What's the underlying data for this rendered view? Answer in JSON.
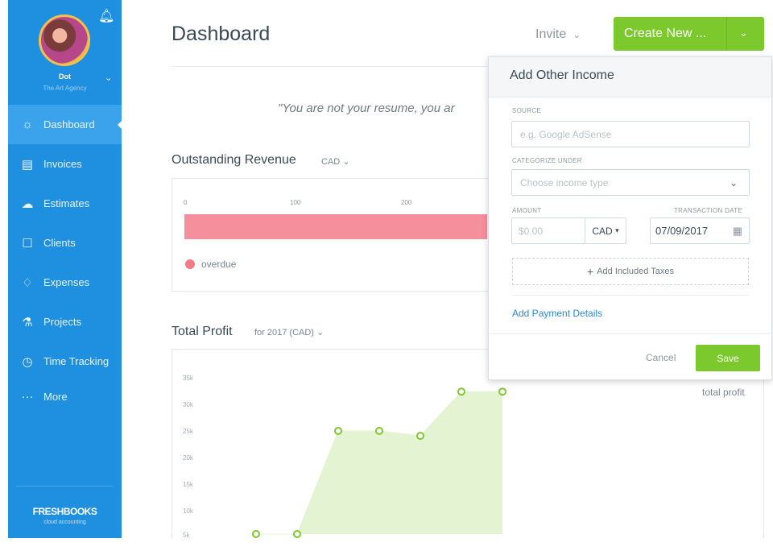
{
  "sidebar": {
    "user_name": "Dot",
    "agency": "The Art Agency",
    "items": [
      {
        "label": "Dashboard",
        "icon": "dashboard-icon",
        "glyph": "☼",
        "active": true
      },
      {
        "label": "Invoices",
        "icon": "invoice-icon",
        "glyph": "▤"
      },
      {
        "label": "Estimates",
        "icon": "estimate-icon",
        "glyph": "☁"
      },
      {
        "label": "Clients",
        "icon": "clients-icon",
        "glyph": "☐"
      },
      {
        "label": "Expenses",
        "icon": "expenses-icon",
        "glyph": "♢"
      },
      {
        "label": "Projects",
        "icon": "projects-icon",
        "glyph": "⚗"
      },
      {
        "label": "Time Tracking",
        "icon": "stopwatch-icon",
        "glyph": "◷"
      }
    ],
    "more_label": "More",
    "logo_text": "FRESHBOOKS",
    "logo_sub": "cloud accounting"
  },
  "header": {
    "title": "Dashboard",
    "invite_label": "Invite",
    "create_label": "Create New ..."
  },
  "quote": "\"You are not your resume, you ar",
  "outstanding": {
    "title": "Outstanding Revenue",
    "currency": "CAD",
    "ticks": [
      "0",
      "100",
      "200"
    ],
    "legend": "overdue",
    "colors": {
      "overdue": "#f58f9b"
    }
  },
  "profit": {
    "title": "Total Profit",
    "period": "for 2017 (CAD)",
    "legend": "total profit",
    "y_ticks": [
      "35k",
      "30k",
      "25k",
      "20k",
      "15k",
      "10k",
      "5k"
    ],
    "colors": {
      "area": "#e4f3d2",
      "line": "#7bc92c"
    }
  },
  "chart_data": {
    "type": "area",
    "series": [
      {
        "values": [
          4000,
          4000,
          25000,
          25000,
          24000,
          33000,
          33000
        ]
      }
    ],
    "ylim": [
      4000,
      35000
    ],
    "legend": "total profit"
  },
  "popup": {
    "title": "Add Other Income",
    "source_label": "SOURCE",
    "source_placeholder": "e.g. Google AdSense",
    "category_label": "CATEGORIZE UNDER",
    "category_placeholder": "Choose income type",
    "amount_label": "AMOUNT",
    "amount_placeholder": "$0.00",
    "currency": "CAD",
    "date_label": "TRANSACTION DATE",
    "date_value": "07/09/2017",
    "add_taxes_label": "Add Included Taxes",
    "payment_link": "Add Payment Details",
    "cancel_label": "Cancel",
    "save_label": "Save"
  },
  "colors": {
    "sidebar": "#1f8fe0",
    "accent": "#7bc92c",
    "link": "#2b8ad8"
  }
}
